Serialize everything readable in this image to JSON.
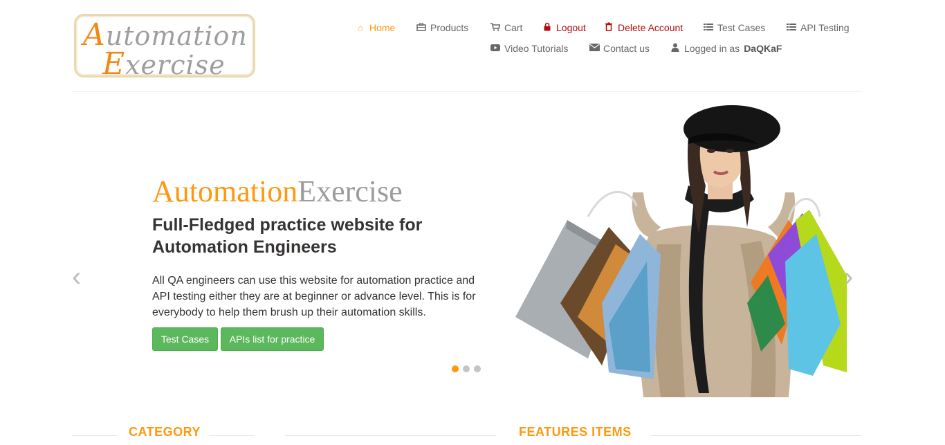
{
  "logo": {
    "line1_cap": "A",
    "line1_rest": "utomation",
    "line2_cap": "E",
    "line2_rest": "xercise"
  },
  "nav": {
    "home": "Home",
    "products": "Products",
    "cart": "Cart",
    "logout": "Logout",
    "delete_account": "Delete Account",
    "test_cases": "Test Cases",
    "api_testing": "API Testing",
    "video_tutorials": "Video Tutorials",
    "contact_us": "Contact us",
    "logged_in_prefix": "Logged in as",
    "username": "DaQKaF"
  },
  "hero": {
    "brand_part1": "Automation",
    "brand_part2": "Exercise",
    "heading": "Full-Fledged practice website for Automation Engineers",
    "description": "All QA engineers can use this website for automation practice and API testing either they are at beginner or advance level. This is for everybody to help them brush up their automation skills.",
    "button_test_cases": "Test Cases",
    "button_apis": "APIs list for practice",
    "prev_arrow": "‹",
    "next_arrow": "›"
  },
  "sections": {
    "category": "CATEGORY",
    "features": "FEATURES ITEMS"
  },
  "colors": {
    "accent": "#fe980f",
    "danger": "#b40a0a",
    "button_green": "#5cb85c",
    "text_dark": "#363432"
  },
  "icons": {
    "home": "home-icon",
    "products": "briefcase-icon",
    "cart": "cart-icon",
    "logout": "lock-icon",
    "delete": "trash-icon",
    "test_cases": "list-icon",
    "api": "list-icon",
    "video": "youtube-play-icon",
    "contact": "envelope-icon",
    "user": "user-icon"
  }
}
